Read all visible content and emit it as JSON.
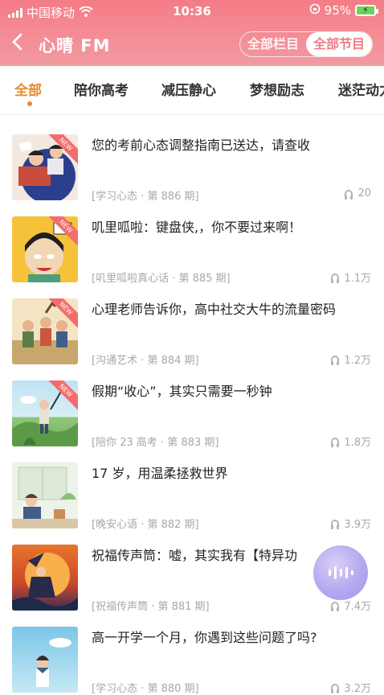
{
  "status": {
    "carrier": "中国移动",
    "time": "10:36",
    "battery": "95%"
  },
  "header": {
    "title": "心晴 FM",
    "seg_off": "全部栏目",
    "seg_on": "全部节目"
  },
  "tabs": [
    "全部",
    "陪你高考",
    "减压静心",
    "梦想励志",
    "迷茫动力"
  ],
  "items": [
    {
      "title": "您的考前心态调整指南已送达，请查收",
      "meta": "[学习心态 · 第 886 期]",
      "plays": "20",
      "new": true,
      "thumb": "study-people-thumbnail"
    },
    {
      "title": "叽里呱啦：键盘侠,，你不要过来啊！",
      "meta": "[叽里呱啦真心话 · 第 885 期]",
      "plays": "1.1万",
      "new": true,
      "thumb": "crying-character-thumbnail"
    },
    {
      "title": "心理老师告诉你，高中社交大牛的流量密码",
      "meta": "[沟通艺术 · 第 884 期]",
      "plays": "1.2万",
      "new": true,
      "thumb": "friends-gathering-thumbnail"
    },
    {
      "title": "假期“收心”，其实只需要一秒钟",
      "meta": "[陪你 23 高考 · 第 883 期]",
      "plays": "1.8万",
      "new": true,
      "thumb": "hiking-girl-thumbnail"
    },
    {
      "title": "17 岁，用温柔拯救世界",
      "meta": "[晚安心语 · 第 882 期]",
      "plays": "3.9万",
      "new": false,
      "thumb": "girl-reading-window-thumbnail"
    },
    {
      "title": "祝福传声筒：嘘，其实我有【特异功",
      "meta": "[祝福传声筒 · 第 881 期]",
      "plays": "7.4万",
      "new": false,
      "thumb": "witch-moon-thumbnail"
    },
    {
      "title": "高一开学一个月，你遇到这些问题了吗?",
      "meta": "[学习心态 · 第 880 期]",
      "plays": "3.2万",
      "new": false,
      "thumb": "student-sky-thumbnail"
    }
  ],
  "colors": {
    "accent": "#e98a2b",
    "header": "#f47c86"
  }
}
